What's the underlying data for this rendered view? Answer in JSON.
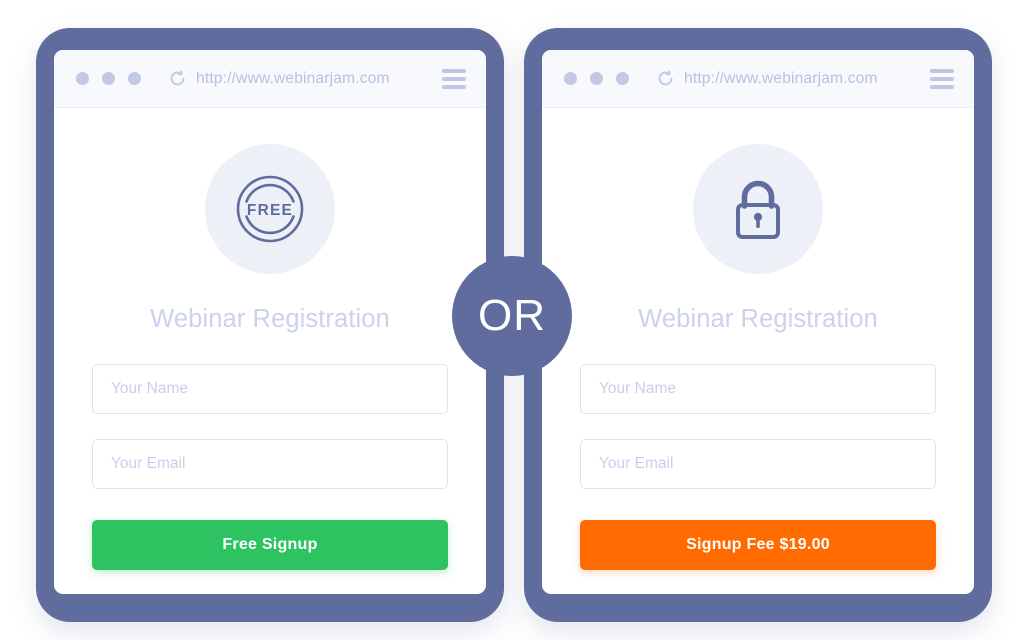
{
  "connector": {
    "label": "OR"
  },
  "cards": [
    {
      "id": "free",
      "browser": {
        "url": "http://www.webinarjam.com",
        "reload_icon": "reload-icon",
        "menu_icon": "hamburger-menu-icon",
        "dots": [
          "window-dot",
          "window-dot",
          "window-dot"
        ]
      },
      "badge_icon": "free-stamp-icon",
      "badge_text": "FREE",
      "heading": "Webinar Registration",
      "fields": [
        {
          "name": "name",
          "placeholder": "Your Name",
          "value": ""
        },
        {
          "name": "email",
          "placeholder": "Your Email",
          "value": ""
        }
      ],
      "cta_label": "Free Signup",
      "cta_color": "#2cc360"
    },
    {
      "id": "paid",
      "browser": {
        "url": "http://www.webinarjam.com",
        "reload_icon": "reload-icon",
        "menu_icon": "hamburger-menu-icon",
        "dots": [
          "window-dot",
          "window-dot",
          "window-dot"
        ]
      },
      "badge_icon": "lock-icon",
      "heading": "Webinar Registration",
      "fields": [
        {
          "name": "name",
          "placeholder": "Your Name",
          "value": ""
        },
        {
          "name": "email",
          "placeholder": "Your Email",
          "value": ""
        }
      ],
      "cta_label": "Signup Fee $19.00",
      "cta_color": "#ff6b00"
    }
  ],
  "colors": {
    "frame": "#5f6c9d",
    "badge_bg": "#eef0f8",
    "icon": "#5f6c9d",
    "heading": "#ccd2ea",
    "field_border": "#dfe4f3",
    "placeholder": "#c9cfe8",
    "green": "#2cc360",
    "orange": "#ff6b00"
  }
}
